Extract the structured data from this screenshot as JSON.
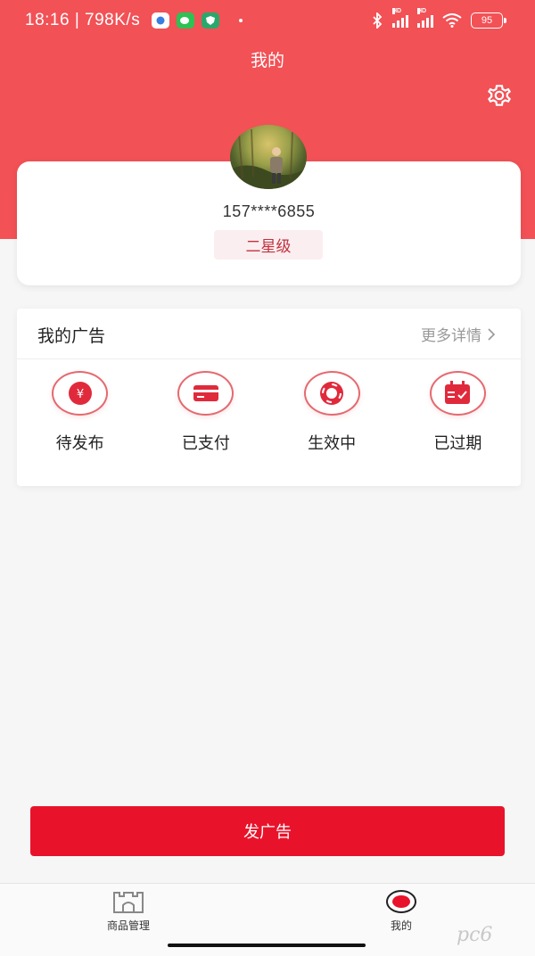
{
  "status_bar": {
    "time": "18:16",
    "speed": "798K/s",
    "battery": "95",
    "hd_label": "HD"
  },
  "header": {
    "title": "我的"
  },
  "profile": {
    "phone": "157****6855",
    "level": "二星级"
  },
  "ads": {
    "title": "我的广告",
    "more": "更多详情",
    "items": [
      {
        "label": "待发布",
        "icon": "yen-icon"
      },
      {
        "label": "已支付",
        "icon": "card-icon"
      },
      {
        "label": "生效中",
        "icon": "lifebuoy-icon"
      },
      {
        "label": "已过期",
        "icon": "calendar-check-icon"
      }
    ]
  },
  "publish_button": "发广告",
  "tabbar": {
    "items": [
      {
        "label": "商品管理",
        "icon": "store-icon",
        "active": false
      },
      {
        "label": "我的",
        "icon": "profile-icon",
        "active": true
      }
    ]
  },
  "watermark": "pc6",
  "colors": {
    "brand": "#f25156",
    "button": "#e8132b",
    "level_text": "#c0323f"
  }
}
